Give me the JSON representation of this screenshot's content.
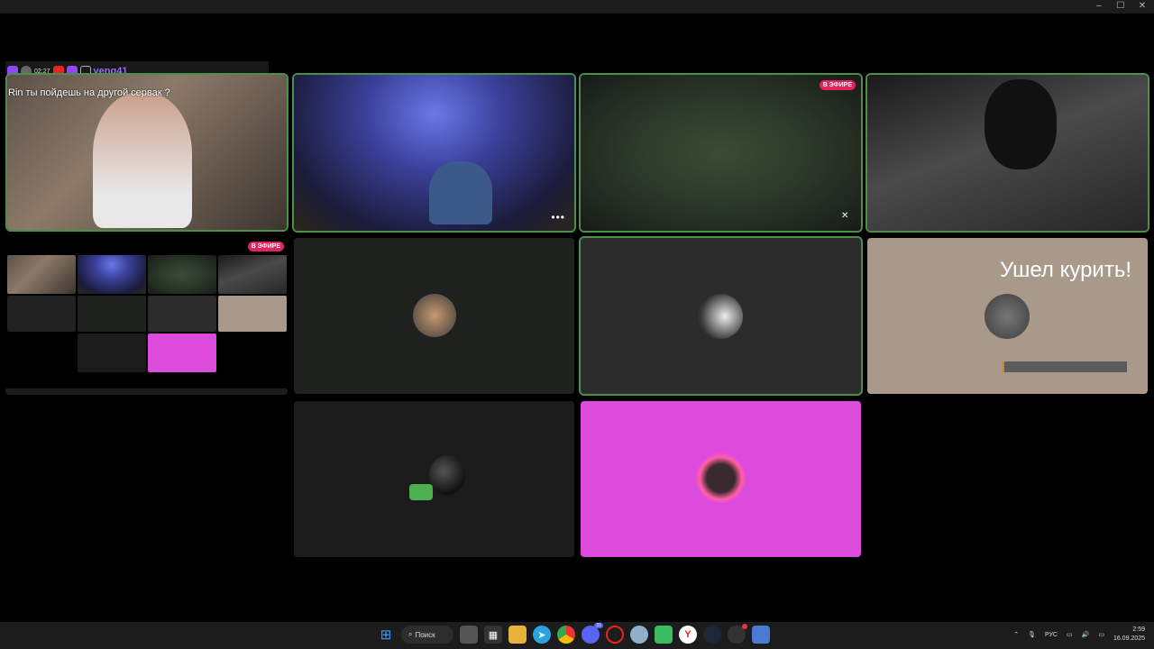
{
  "chat": {
    "time": "02:27",
    "username": "venq41",
    "message": "Rin ты пойдешь на другой сервак ?"
  },
  "badges": {
    "live": "В ЭФИРЕ"
  },
  "tiles": {
    "status_text": "Ушел курить!"
  },
  "taskbar": {
    "search_label": "Поиск",
    "language": "РУС",
    "time": "2:59",
    "date": "16.09.2025",
    "discord_badge": "31"
  },
  "colors": {
    "speaking_border": "#4a8f4a",
    "live_badge": "#e0245e",
    "pink_tile": "#dc4bdc",
    "tan_tile": "#a8998a"
  }
}
